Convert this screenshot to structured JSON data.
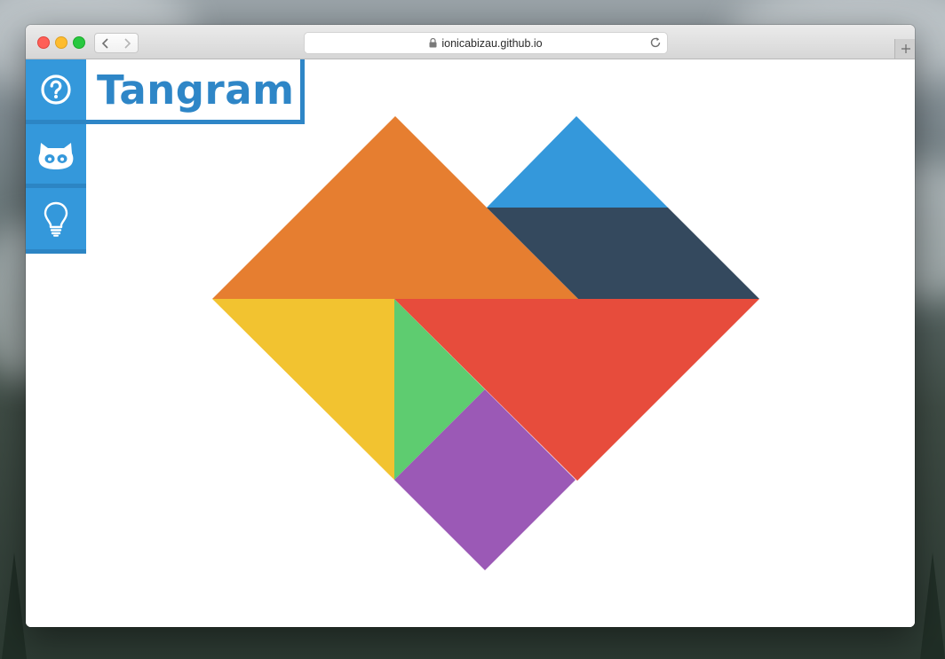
{
  "browser": {
    "url": "ionicabizau.github.io"
  },
  "page": {
    "title": "Tangram"
  },
  "sidebar": {
    "items": [
      {
        "name": "help",
        "icon": "question-circle-icon"
      },
      {
        "name": "github",
        "icon": "github-octocat-icon"
      },
      {
        "name": "idea",
        "icon": "lightbulb-icon"
      }
    ]
  },
  "tangram": {
    "shape": "heart",
    "pieces": [
      {
        "name": "large-triangle-orange",
        "color": "#e67e30"
      },
      {
        "name": "small-triangle-blue",
        "color": "#3498db"
      },
      {
        "name": "parallelogram-navy",
        "color": "#34495e"
      },
      {
        "name": "large-triangle-red",
        "color": "#e74c3c"
      },
      {
        "name": "medium-triangle-yellow",
        "color": "#f2c330"
      },
      {
        "name": "small-triangle-green",
        "color": "#5ecc70"
      },
      {
        "name": "square-purple",
        "color": "#9b59b6"
      }
    ]
  },
  "colors": {
    "accent": "#3498db",
    "title": "#2e86c7"
  }
}
